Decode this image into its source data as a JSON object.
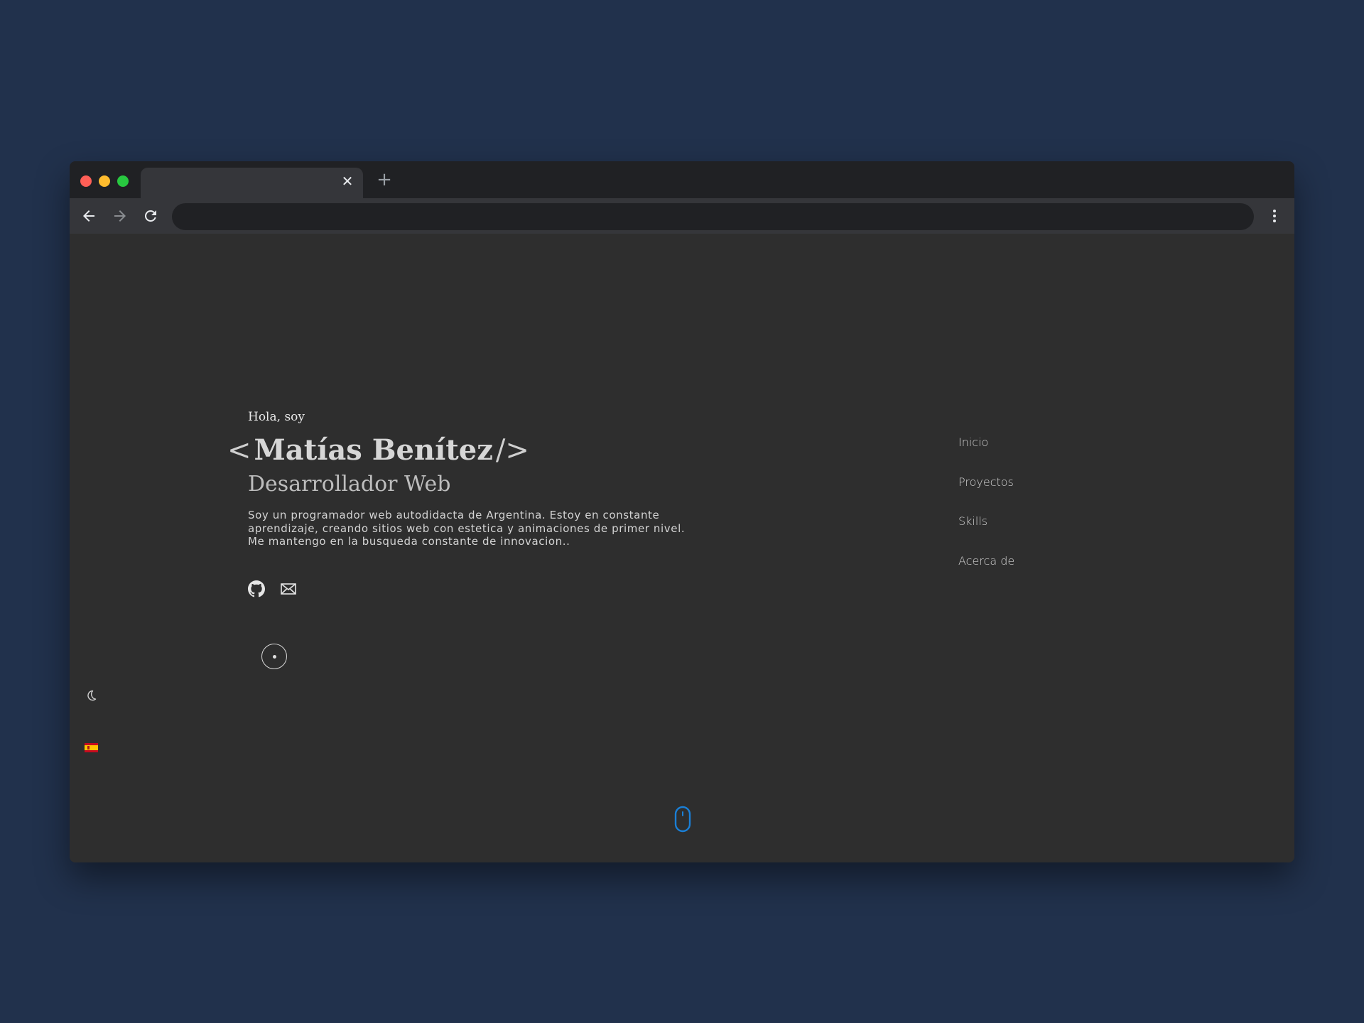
{
  "browser": {
    "tab_title": "",
    "tab_close_glyph": "✕",
    "new_tab_glyph": "+",
    "address": ""
  },
  "hero": {
    "greeting": "Hola, soy",
    "bracket_open": "<",
    "name": "Matías Benítez",
    "bracket_close": "/>",
    "role": "Desarrollador Web",
    "bio": "Soy un programador web autodidacta de Argentina. Estoy en constante aprendizaje, creando sitios web con estetica y animaciones de primer nivel. Me mantengo en la busqueda constante de innovacion.."
  },
  "social": [
    {
      "icon": "github-icon"
    },
    {
      "icon": "mail-icon"
    }
  ],
  "nav": {
    "items": [
      {
        "label": "Inicio"
      },
      {
        "label": "Proyectos"
      },
      {
        "label": "Skills"
      },
      {
        "label": "Acerca de"
      }
    ]
  },
  "controls": {
    "theme_icon": "moon-icon",
    "language_flag": "spain-flag",
    "scroll_icon": "mouse-scroll-icon"
  },
  "colors": {
    "desktop_background": "#21314c",
    "page_background": "#2e2e2e",
    "accent": "#1a7fd6",
    "text": "#dcdcdc"
  }
}
